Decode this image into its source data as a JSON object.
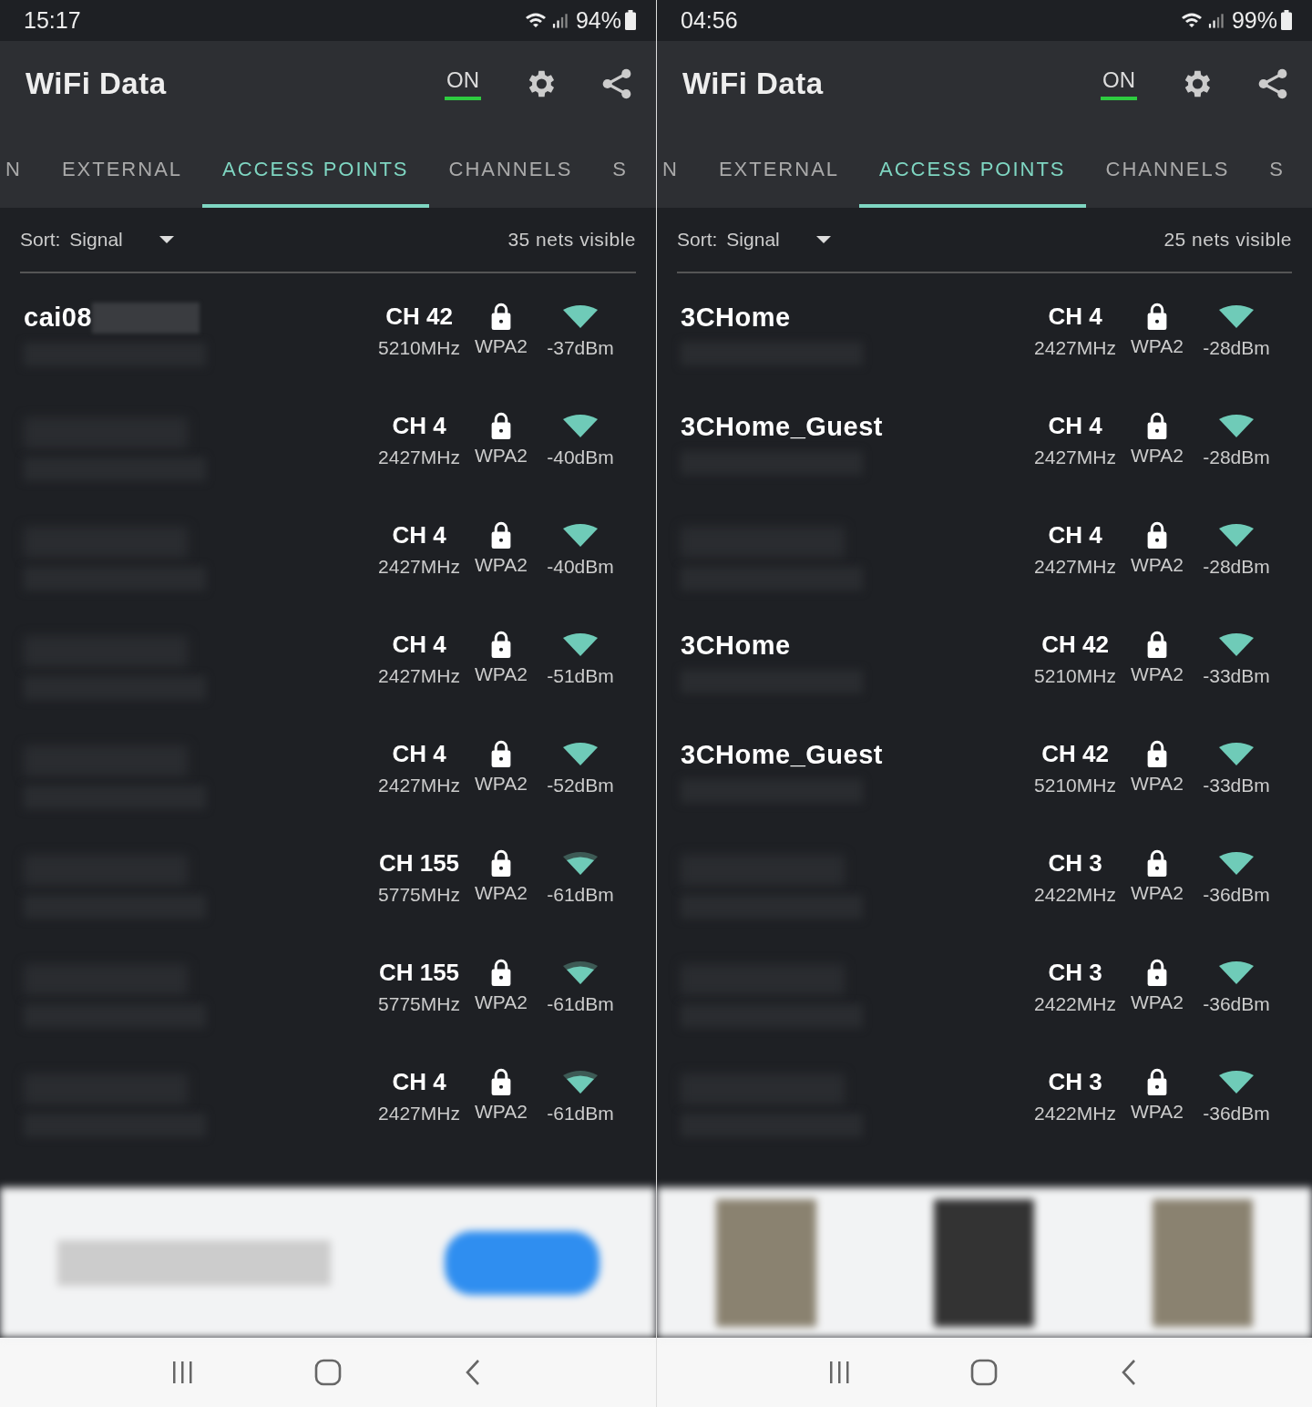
{
  "screens": [
    {
      "status_bar": {
        "time": "15:17",
        "battery": "94%"
      },
      "app_bar": {
        "title": "WiFi Data",
        "toggle": "ON"
      },
      "tabs": [
        {
          "label": "N",
          "selected": false
        },
        {
          "label": "EXTERNAL",
          "selected": false
        },
        {
          "label": "ACCESS POINTS",
          "selected": true
        },
        {
          "label": "CHANNELS",
          "selected": false
        },
        {
          "label": "S",
          "selected": false
        }
      ],
      "sort": {
        "label": "Sort:",
        "value": "Signal"
      },
      "count": "35 nets visible",
      "networks": [
        {
          "ssid": "cai08",
          "ssid_cut": true,
          "channel": "CH 42",
          "frequency": "5210MHz",
          "security": "WPA2",
          "signal": "-37dBm",
          "weak": false
        },
        {
          "channel": "CH 4",
          "frequency": "2427MHz",
          "security": "WPA2",
          "signal": "-40dBm",
          "weak": false
        },
        {
          "channel": "CH 4",
          "frequency": "2427MHz",
          "security": "WPA2",
          "signal": "-40dBm",
          "weak": false
        },
        {
          "channel": "CH 4",
          "frequency": "2427MHz",
          "security": "WPA2",
          "signal": "-51dBm",
          "weak": false
        },
        {
          "channel": "CH 4",
          "frequency": "2427MHz",
          "security": "WPA2",
          "signal": "-52dBm",
          "weak": false
        },
        {
          "channel": "CH 155",
          "frequency": "5775MHz",
          "security": "WPA2",
          "signal": "-61dBm",
          "weak": true
        },
        {
          "channel": "CH 155",
          "frequency": "5775MHz",
          "security": "WPA2",
          "signal": "-61dBm",
          "weak": true
        },
        {
          "channel": "CH 4",
          "frequency": "2427MHz",
          "security": "WPA2",
          "signal": "-61dBm",
          "weak": true
        }
      ]
    },
    {
      "status_bar": {
        "time": "04:56",
        "battery": "99%"
      },
      "app_bar": {
        "title": "WiFi Data",
        "toggle": "ON"
      },
      "tabs": [
        {
          "label": "N",
          "selected": false
        },
        {
          "label": "EXTERNAL",
          "selected": false
        },
        {
          "label": "ACCESS POINTS",
          "selected": true
        },
        {
          "label": "CHANNELS",
          "selected": false
        },
        {
          "label": "S",
          "selected": false
        }
      ],
      "sort": {
        "label": "Sort:",
        "value": "Signal"
      },
      "count": "25 nets visible",
      "networks": [
        {
          "ssid": "3CHome",
          "ssid_cut": false,
          "channel": "CH 4",
          "frequency": "2427MHz",
          "security": "WPA2",
          "signal": "-28dBm",
          "weak": false
        },
        {
          "ssid": "3CHome_Guest",
          "ssid_cut": false,
          "channel": "CH 4",
          "frequency": "2427MHz",
          "security": "WPA2",
          "signal": "-28dBm",
          "weak": false
        },
        {
          "channel": "CH 4",
          "frequency": "2427MHz",
          "security": "WPA2",
          "signal": "-28dBm",
          "weak": false
        },
        {
          "ssid": "3CHome",
          "ssid_cut": false,
          "channel": "CH 42",
          "frequency": "5210MHz",
          "security": "WPA2",
          "signal": "-33dBm",
          "weak": false
        },
        {
          "ssid": "3CHome_Guest",
          "ssid_cut": false,
          "channel": "CH 42",
          "frequency": "5210MHz",
          "security": "WPA2",
          "signal": "-33dBm",
          "weak": false
        },
        {
          "channel": "CH 3",
          "frequency": "2422MHz",
          "security": "WPA2",
          "signal": "-36dBm",
          "weak": false
        },
        {
          "channel": "CH 3",
          "frequency": "2422MHz",
          "security": "WPA2",
          "signal": "-36dBm",
          "weak": false
        },
        {
          "channel": "CH 3",
          "frequency": "2422MHz",
          "security": "WPA2",
          "signal": "-36dBm",
          "weak": false
        }
      ]
    }
  ]
}
